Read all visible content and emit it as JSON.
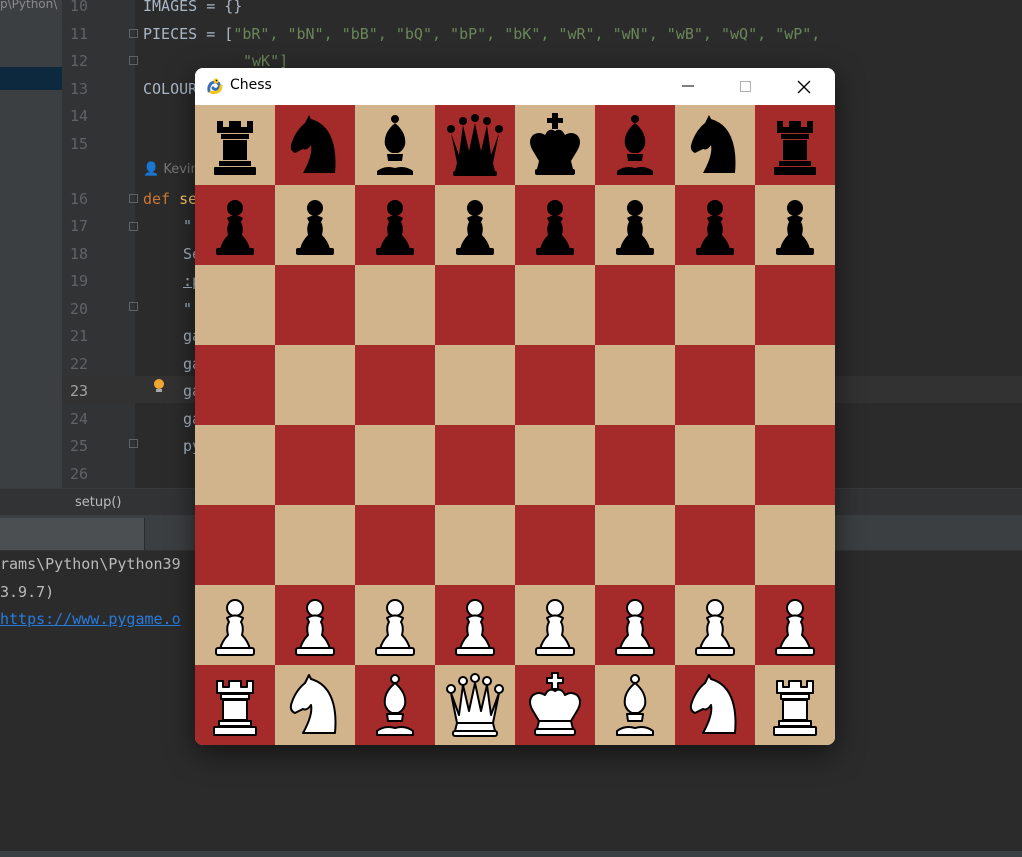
{
  "ide": {
    "project_path_fragment": "p\\Python\\",
    "line_numbers": [
      "10",
      "11",
      "12",
      "13",
      "14",
      "15",
      "16",
      "17",
      "18",
      "19",
      "20",
      "21",
      "22",
      "23",
      "24",
      "25",
      "26"
    ],
    "active_line": "23",
    "code": {
      "line10": "IMAGES = {}",
      "line11_prefix": "PIECES = [",
      "line11_items": "\"bR\", \"bN\", \"bB\", \"bQ\", \"bP\", \"bK\", \"wR\", \"wN\", \"wB\", \"wQ\", \"wP\",",
      "line12": "\"wK\"]",
      "line13": "COLOUR",
      "author": "Kevin",
      "line16_kw": "def",
      "line16_rest": "se",
      "line17": "\"",
      "line18": "Se",
      "line19": ":p",
      "line20": "\"",
      "line21": "ga",
      "line22": "ga",
      "line23": "ga",
      "line24": "ga",
      "line25": "py"
    },
    "breadcrumb": "setup()"
  },
  "console": {
    "lines": [
      "rams\\Python\\Python39",
      "3.9.7)"
    ],
    "link": "https://www.pygame.o"
  },
  "window": {
    "title": "Chess",
    "app_icon": "pygame-snake-icon",
    "controls": [
      "minimize-icon",
      "maximize-icon",
      "close-icon"
    ]
  },
  "board": {
    "light_color": "#d2b48c",
    "dark_color": "#a52a2a",
    "ranks": [
      [
        "bR",
        "bN",
        "bB",
        "bQ",
        "bK",
        "bB",
        "bN",
        "bR"
      ],
      [
        "bP",
        "bP",
        "bP",
        "bP",
        "bP",
        "bP",
        "bP",
        "bP"
      ],
      [
        "",
        "",
        "",
        "",
        "",
        "",
        "",
        ""
      ],
      [
        "",
        "",
        "",
        "",
        "",
        "",
        "",
        ""
      ],
      [
        "",
        "",
        "",
        "",
        "",
        "",
        "",
        ""
      ],
      [
        "",
        "",
        "",
        "",
        "",
        "",
        "",
        ""
      ],
      [
        "wP",
        "wP",
        "wP",
        "wP",
        "wP",
        "wP",
        "wP",
        "wP"
      ],
      [
        "wR",
        "wN",
        "wB",
        "wQ",
        "wK",
        "wB",
        "wN",
        "wR"
      ]
    ]
  }
}
